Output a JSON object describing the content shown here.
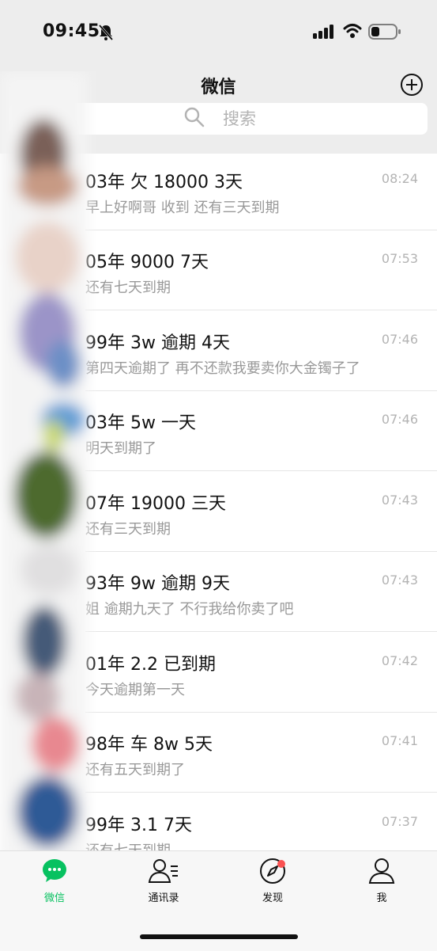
{
  "status_bar": {
    "time": "09:45"
  },
  "nav": {
    "title": "微信"
  },
  "search": {
    "placeholder": "搜索"
  },
  "chats": [
    {
      "name": "03年 欠 18000 3天",
      "message": "早上好啊哥 收到 还有三天到期",
      "time": "08:24"
    },
    {
      "name": "05年 9000 7天",
      "message": "还有七天到期",
      "time": "07:53"
    },
    {
      "name": "99年 3w 逾期 4天",
      "message": "第四天逾期了 再不还款我要卖你大金镯子了",
      "time": "07:46"
    },
    {
      "name": "03年 5w 一天",
      "message": "明天到期了",
      "time": "07:46"
    },
    {
      "name": "07年 19000 三天",
      "message": "还有三天到期",
      "time": "07:43"
    },
    {
      "name": "93年 9w 逾期 9天",
      "message": "姐 逾期九天了 不行我给你卖了吧",
      "time": "07:43"
    },
    {
      "name": "01年 2.2 已到期",
      "message": "今天逾期第一天",
      "time": "07:42"
    },
    {
      "name": "98年 车 8w 5天",
      "message": "还有五天到期了",
      "time": "07:41"
    },
    {
      "name": "99年 3.1 7天",
      "message": "还有七天到期",
      "time": "07:37"
    }
  ],
  "tabs": [
    {
      "label": "微信",
      "icon": "chat-bubble-icon",
      "active": true
    },
    {
      "label": "通讯录",
      "icon": "contacts-icon",
      "active": false
    },
    {
      "label": "发现",
      "icon": "compass-icon",
      "active": false,
      "badge": true
    },
    {
      "label": "我",
      "icon": "person-icon",
      "active": false
    }
  ],
  "colors": {
    "accent": "#07c160",
    "badge": "#fa5151",
    "header_bg": "#ededed"
  }
}
